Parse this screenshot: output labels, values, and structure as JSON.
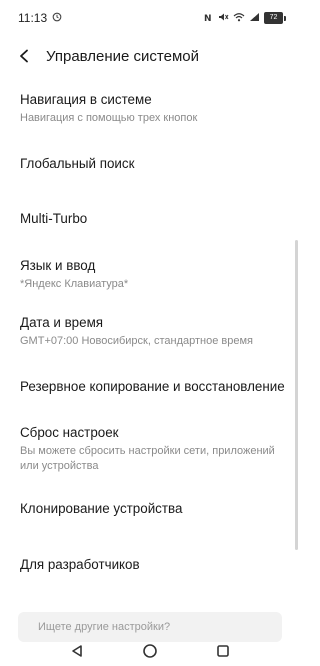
{
  "status_bar": {
    "time": "11:13",
    "battery": "72",
    "icons": [
      "sync-icon",
      "nfc-icon",
      "mute-icon",
      "wifi-icon",
      "signal-icon",
      "battery-icon"
    ]
  },
  "header": {
    "title": "Управление системой",
    "back_icon": "back-arrow-icon"
  },
  "items": [
    {
      "title": "Навигация в системе",
      "subtitle": "Навигация с помощью трех кнопок"
    },
    {
      "title": "Глобальный поиск"
    },
    {
      "title": "Multi-Turbo"
    },
    {
      "title": "Язык и ввод",
      "subtitle": "*Яндекс Клавиатура*"
    },
    {
      "title": "Дата и время",
      "subtitle": "GMT+07:00 Новосибирск, стандартное время"
    },
    {
      "title": "Резервное копирование и восстановление"
    },
    {
      "title": "Сброс настроек",
      "subtitle": "Вы можете сбросить настройки сети, приложений или устройства"
    },
    {
      "title": "Клонирование устройства"
    },
    {
      "title": "Для разработчиков"
    }
  ],
  "search": {
    "placeholder": "Ищете другие настройки?",
    "value": ""
  },
  "nav_bar": {
    "icons": [
      "back-triangle-icon",
      "home-circle-icon",
      "recents-square-icon"
    ]
  },
  "colors": {
    "background": "#ffffff",
    "text_primary": "#1a1a1a",
    "text_secondary": "#8a8a8a",
    "search_bg": "#f2f2f2"
  }
}
